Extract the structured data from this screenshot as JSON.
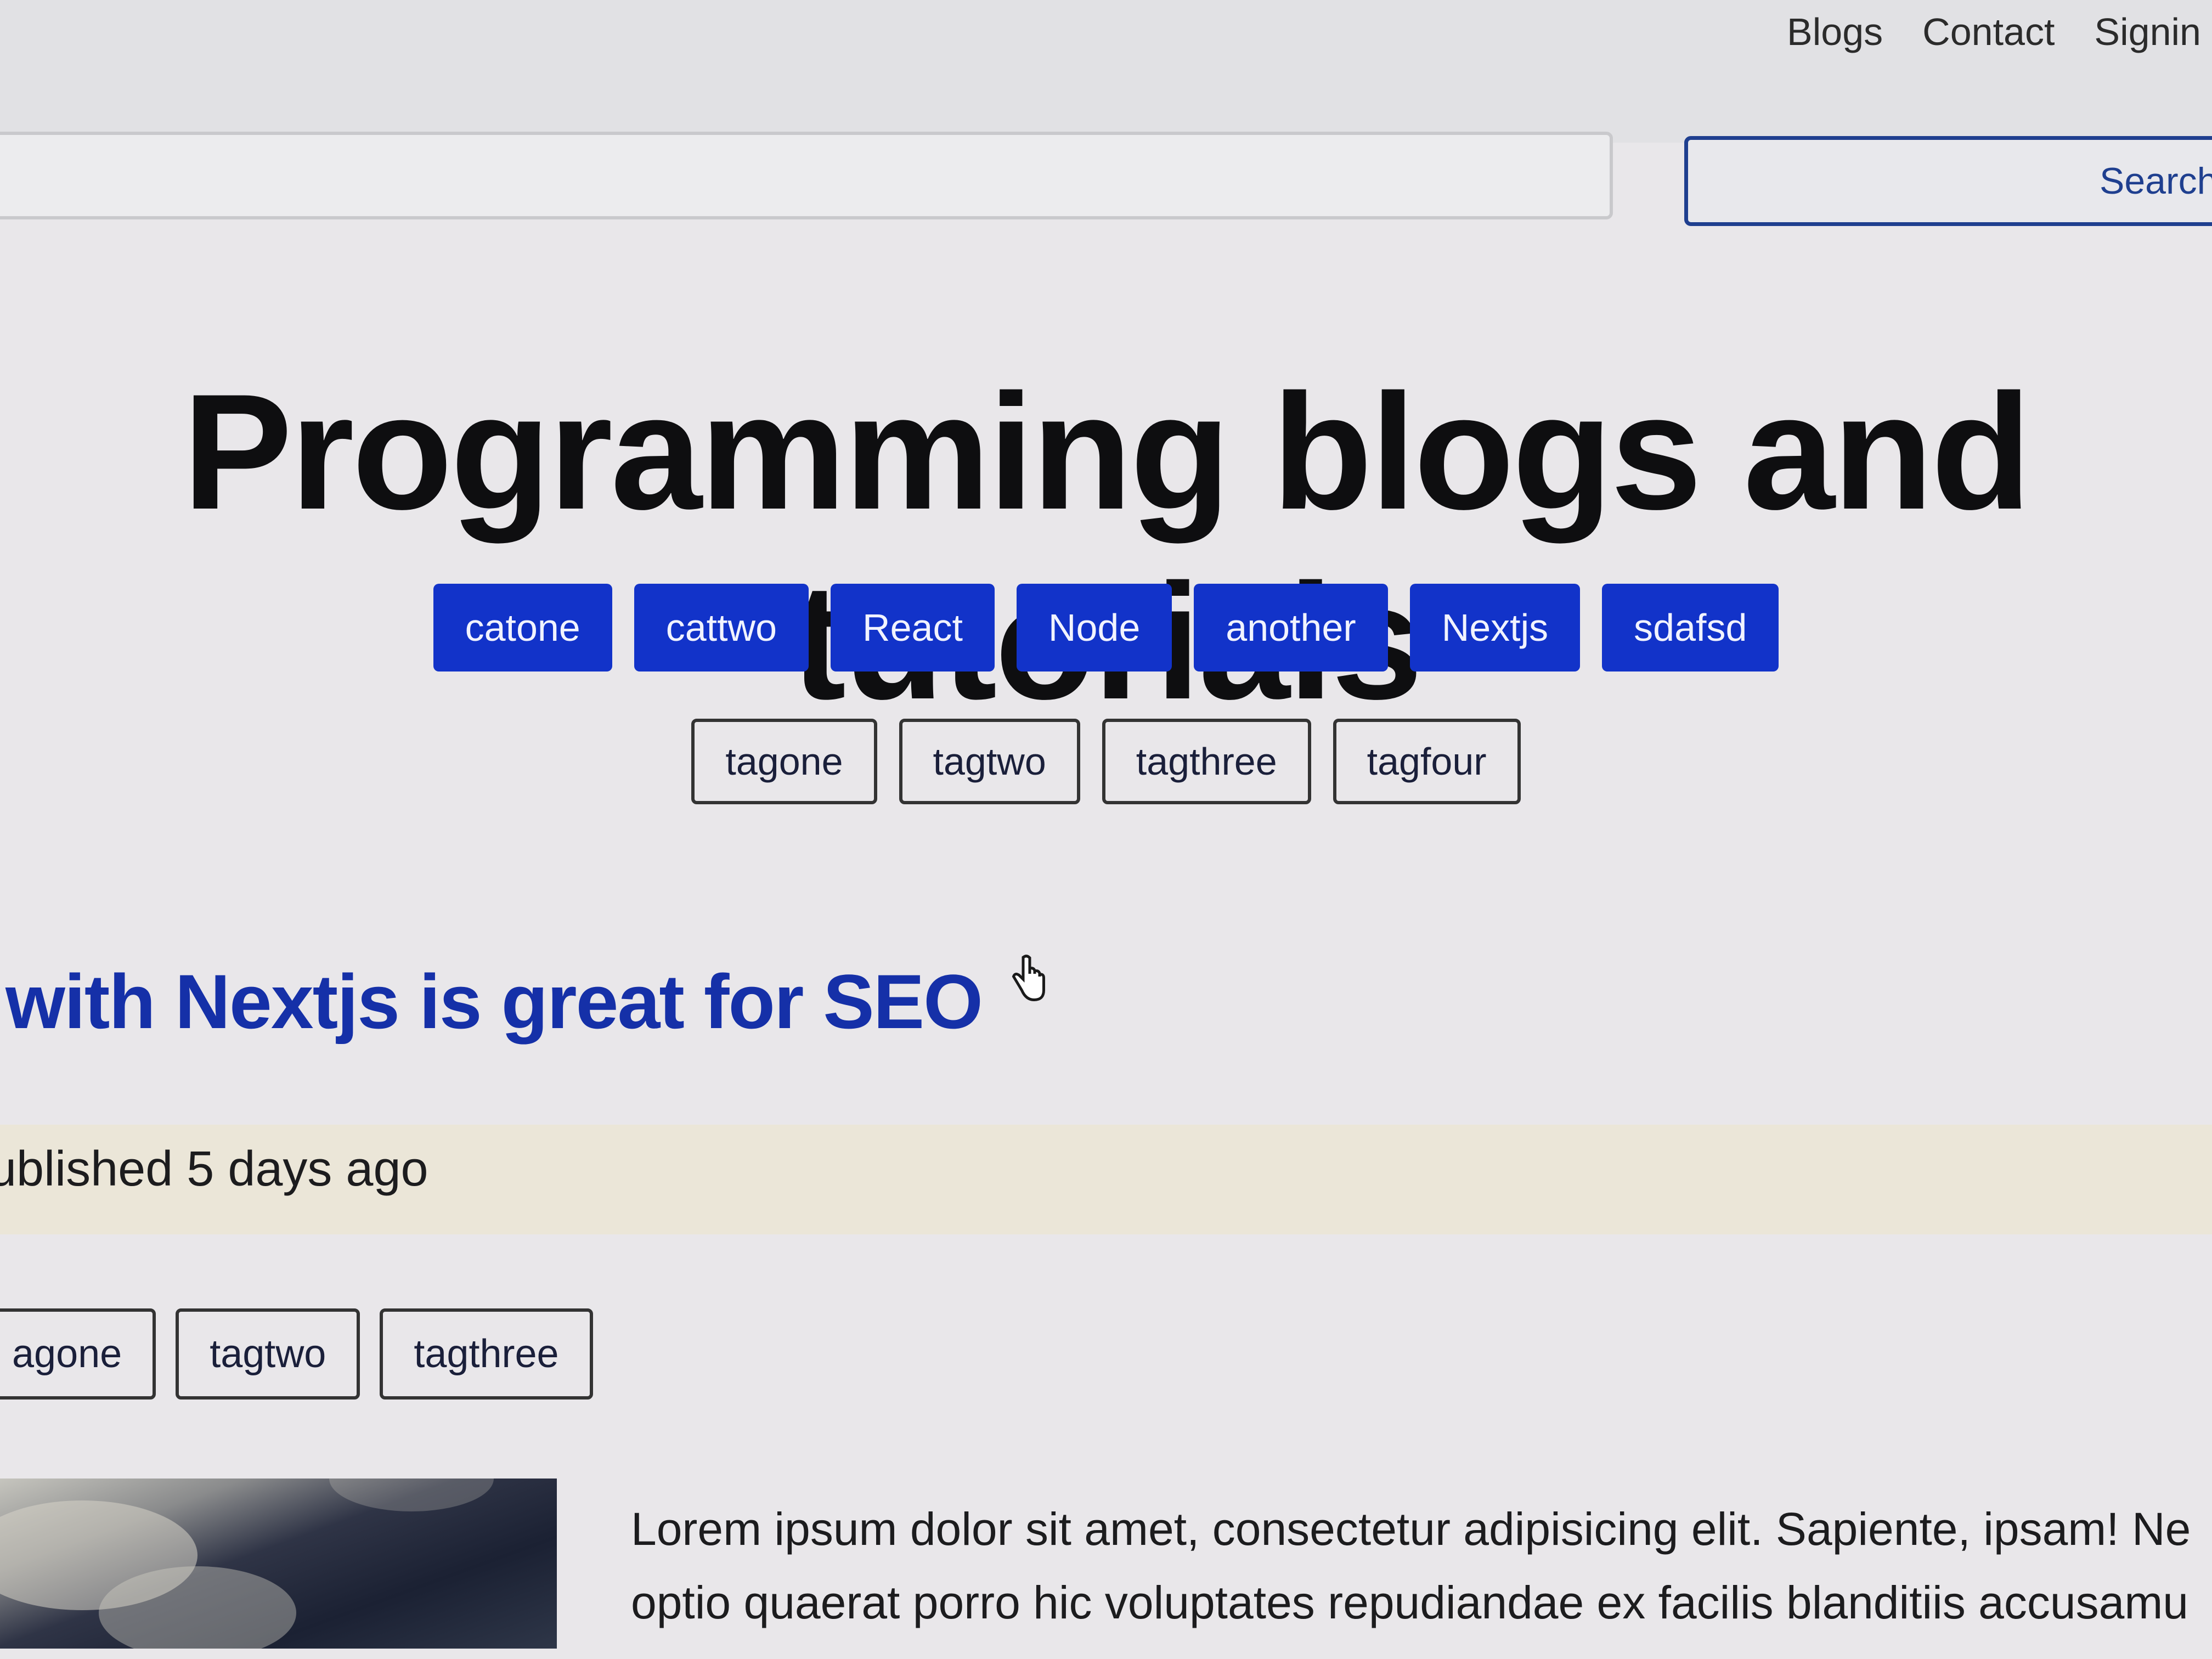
{
  "nav": {
    "items": [
      "Blogs",
      "Contact",
      "Signin"
    ]
  },
  "search": {
    "placeholder": "",
    "button_label": "Search"
  },
  "page": {
    "title": "Programming blogs and tutorials"
  },
  "categories": [
    "catone",
    "cattwo",
    "React",
    "Node",
    "another",
    "Nextjs",
    "sdafsd"
  ],
  "tags": [
    "tagone",
    "tagtwo",
    "tagthree",
    "tagfour"
  ],
  "post": {
    "title": "with Nextjs is great for SEO",
    "meta": "ublished 5 days ago",
    "tags": [
      "agone",
      "tagtwo",
      "tagthree"
    ],
    "excerpt_lines": [
      "Lorem ipsum dolor sit amet, consectetur adipisicing elit. Sapiente, ipsam! Ne",
      "optio quaerat porro hic voluptates repudiandae ex facilis blanditiis accusamu"
    ]
  },
  "colors": {
    "category_bg": "#1233c9",
    "link_blue": "#1530a8",
    "search_border": "#1f3f8f"
  },
  "icons": {
    "cursor": "hand-pointer-icon"
  }
}
